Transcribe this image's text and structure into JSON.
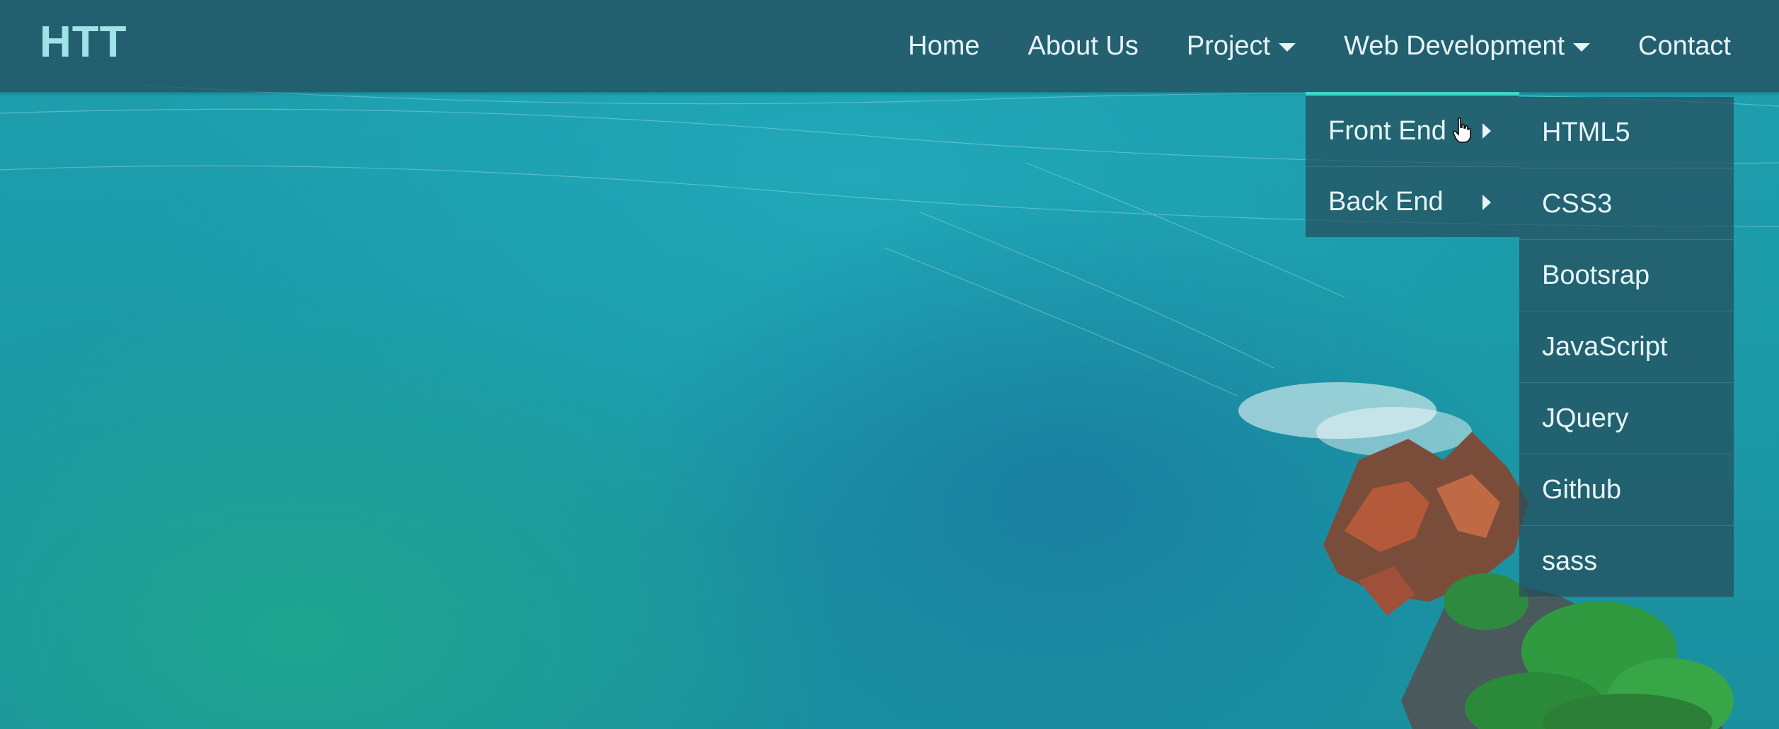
{
  "navbar": {
    "brand": "HTT",
    "items": [
      {
        "label": "Home"
      },
      {
        "label": "About Us"
      },
      {
        "label": "Project"
      },
      {
        "label": "Web Development"
      },
      {
        "label": "Contact"
      }
    ]
  },
  "dropdown": {
    "items": [
      {
        "label": "Front End"
      },
      {
        "label": "Back End"
      }
    ]
  },
  "submenu": {
    "items": [
      {
        "label": "HTML5"
      },
      {
        "label": "CSS3"
      },
      {
        "label": "Bootsrap"
      },
      {
        "label": "JavaScript"
      },
      {
        "label": "JQuery"
      },
      {
        "label": "Github"
      },
      {
        "label": "sass"
      }
    ]
  },
  "colors": {
    "accent": "#3fd5c8",
    "navbar_bg": "#264656",
    "brand": "#9fe3e8"
  },
  "icons": {
    "caret": "caret-down-icon",
    "submenu_arrow": "caret-right-icon",
    "cursor": "hand-pointer-icon"
  }
}
